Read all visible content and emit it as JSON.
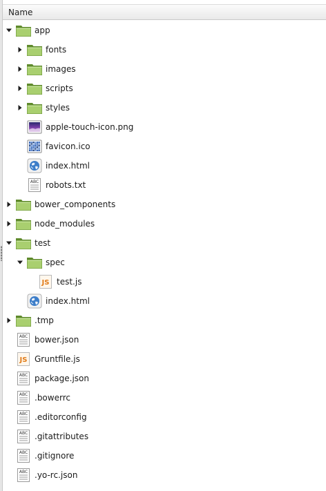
{
  "header": {
    "name_label": "Name"
  },
  "tree": [
    {
      "label": "app",
      "depth": 0,
      "type": "folder",
      "expander": "expanded",
      "icon": "folder-icon"
    },
    {
      "label": "fonts",
      "depth": 1,
      "type": "folder",
      "expander": "collapsed",
      "icon": "folder-icon"
    },
    {
      "label": "images",
      "depth": 1,
      "type": "folder",
      "expander": "collapsed",
      "icon": "folder-icon"
    },
    {
      "label": "scripts",
      "depth": 1,
      "type": "folder",
      "expander": "collapsed",
      "icon": "folder-icon"
    },
    {
      "label": "styles",
      "depth": 1,
      "type": "folder",
      "expander": "collapsed",
      "icon": "folder-icon"
    },
    {
      "label": "apple-touch-icon.png",
      "depth": 1,
      "type": "png",
      "expander": "none",
      "icon": "image-file-icon"
    },
    {
      "label": "favicon.ico",
      "depth": 1,
      "type": "ico",
      "expander": "none",
      "icon": "ico-file-icon"
    },
    {
      "label": "index.html",
      "depth": 1,
      "type": "html",
      "expander": "none",
      "icon": "html-globe-icon"
    },
    {
      "label": "robots.txt",
      "depth": 1,
      "type": "text",
      "expander": "none",
      "icon": "text-file-icon"
    },
    {
      "label": "bower_components",
      "depth": 0,
      "type": "folder",
      "expander": "collapsed",
      "icon": "folder-icon"
    },
    {
      "label": "node_modules",
      "depth": 0,
      "type": "folder",
      "expander": "collapsed",
      "icon": "folder-icon"
    },
    {
      "label": "test",
      "depth": 0,
      "type": "folder",
      "expander": "expanded",
      "icon": "folder-icon"
    },
    {
      "label": "spec",
      "depth": 1,
      "type": "folder",
      "expander": "expanded",
      "icon": "folder-icon"
    },
    {
      "label": "test.js",
      "depth": 2,
      "type": "js",
      "expander": "none",
      "icon": "js-file-icon"
    },
    {
      "label": "index.html",
      "depth": 1,
      "type": "html",
      "expander": "none",
      "icon": "html-globe-icon"
    },
    {
      "label": ".tmp",
      "depth": 0,
      "type": "folder",
      "expander": "collapsed",
      "icon": "folder-icon"
    },
    {
      "label": "bower.json",
      "depth": 0,
      "type": "text",
      "expander": "none",
      "icon": "text-file-icon"
    },
    {
      "label": "Gruntfile.js",
      "depth": 0,
      "type": "js",
      "expander": "none",
      "icon": "js-file-icon"
    },
    {
      "label": "package.json",
      "depth": 0,
      "type": "text",
      "expander": "none",
      "icon": "text-file-icon"
    },
    {
      "label": ".bowerrc",
      "depth": 0,
      "type": "text",
      "expander": "none",
      "icon": "text-file-icon"
    },
    {
      "label": ".editorconfig",
      "depth": 0,
      "type": "text",
      "expander": "none",
      "icon": "text-file-icon"
    },
    {
      "label": ".gitattributes",
      "depth": 0,
      "type": "text",
      "expander": "none",
      "icon": "text-file-icon"
    },
    {
      "label": ".gitignore",
      "depth": 0,
      "type": "text",
      "expander": "none",
      "icon": "text-file-icon"
    },
    {
      "label": ".yo-rc.json",
      "depth": 0,
      "type": "text",
      "expander": "none",
      "icon": "text-file-icon"
    }
  ],
  "colors": {
    "folder_dark": "#5f8a2c",
    "folder_light": "#a9cf6f",
    "js_accent": "#e07b18",
    "globe_blue": "#3d7ec9"
  },
  "icon_text": {
    "text_file": "ABC",
    "js_file": "JS"
  }
}
